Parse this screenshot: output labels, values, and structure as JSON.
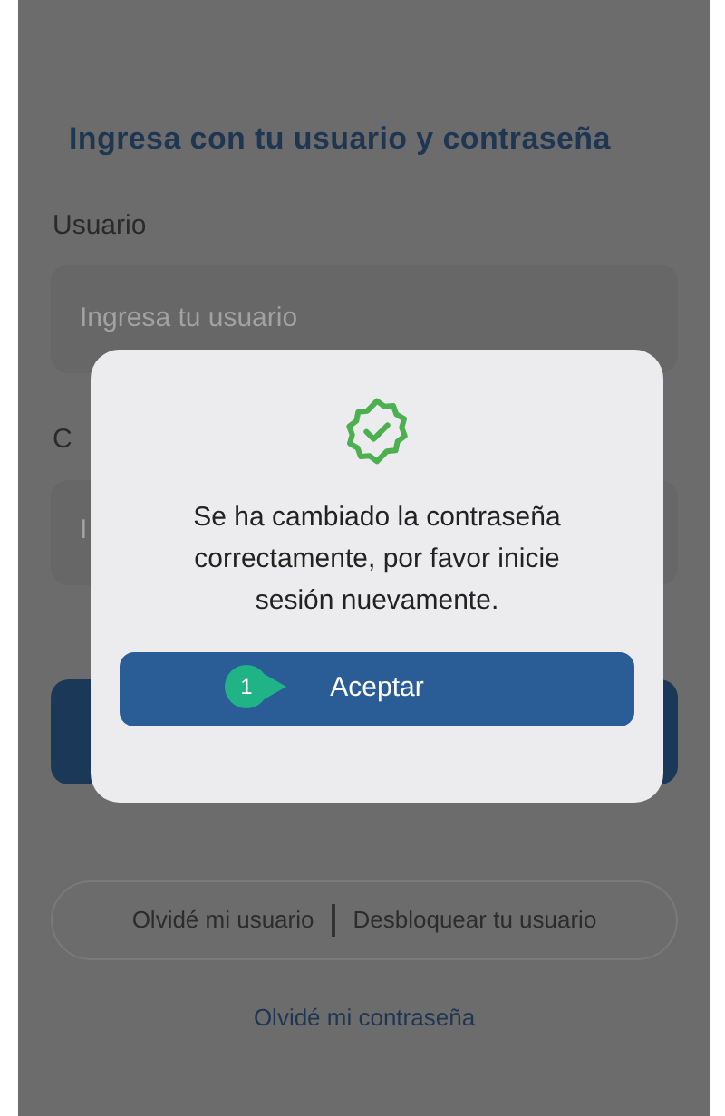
{
  "login": {
    "title": "Ingresa con tu usuario y contraseña",
    "user_label": "Usuario",
    "user_placeholder": "Ingresa tu usuario",
    "password_label": "C",
    "password_placeholder": "I"
  },
  "links": {
    "left": "Olvidé mi usuario",
    "right": "Desbloquear tu usuario",
    "bottom": "Olvidé mi contraseña"
  },
  "dialog": {
    "message": "Se ha cambiado la contraseña correctamente, por favor inicie sesión nuevamente.",
    "button": "Aceptar",
    "step_marker": "1"
  }
}
